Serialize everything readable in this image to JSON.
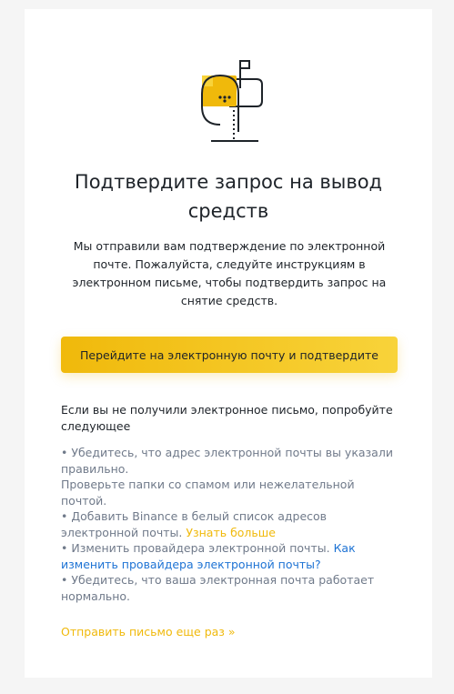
{
  "title": "Подтвердите запрос на вывод средств",
  "subtitle": "Мы отправили вам подтверждение по электронной почте. Пожалуйста, следуйте инструкциям в электронном письме, чтобы подтвердить запрос на снятие средств.",
  "primary_button": "Перейдите на электронную почту и подтвердите",
  "help_heading": "Если вы не получили электронное письмо, попробуйте следующее",
  "tips": {
    "tip1": "• Убедитесь, что адрес электронной почты вы указали правильно.",
    "tip2": "Проверьте папки со спамом или нежелательной почтой.",
    "tip3": "• Добавить Binance в белый список адресов электронной почты.",
    "tip3_link": "Узнать больше",
    "tip4": "• Изменить провайдера электронной почты.",
    "tip4_link": "Как изменить провайдера электронной почты?",
    "tip5": "• Убедитесь, что ваша электронная почта работает нормально."
  },
  "resend_link": "Отправить письмо еще раз »",
  "colors": {
    "accent_yellow": "#f0b90b",
    "link_blue": "#1e73d4",
    "text_dark": "#1e2329",
    "text_muted": "#707a8a"
  },
  "icons": {
    "illustration": "mailbox-icon"
  }
}
